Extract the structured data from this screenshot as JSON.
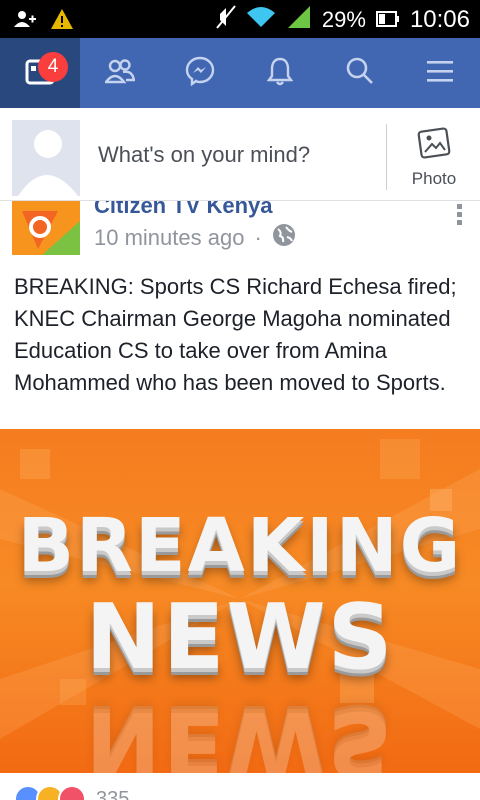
{
  "status_bar": {
    "battery": "29%",
    "time": "10:06",
    "icons": [
      "person-add-icon",
      "warning-icon",
      "mute-icon",
      "wifi-icon",
      "signal-icon",
      "battery-icon"
    ]
  },
  "navbar": {
    "notification_count": "4",
    "items": [
      "news-feed-icon",
      "friends-icon",
      "messenger-icon",
      "notifications-icon",
      "search-icon",
      "menu-icon"
    ],
    "colors": {
      "bar": "#4267b2",
      "active": "#29487d",
      "badge": "#fa3e3e"
    }
  },
  "composer": {
    "placeholder": "What's on your mind?",
    "photo_label": "Photo"
  },
  "post": {
    "page_name": "Citizen TV Kenya",
    "time": "10 minutes ago",
    "separator": "·",
    "privacy_icon": "globe-icon",
    "text": "BREAKING: Sports CS Richard Echesa fired; KNEC Chairman George Magoha nominated Education CS to take over from Amina Mohammed who has been moved to Sports.",
    "image_line1": "BREAKING",
    "image_line2": "NEWS",
    "reaction_count": "335",
    "reactions": [
      "like-icon",
      "haha-icon",
      "love-icon"
    ]
  }
}
